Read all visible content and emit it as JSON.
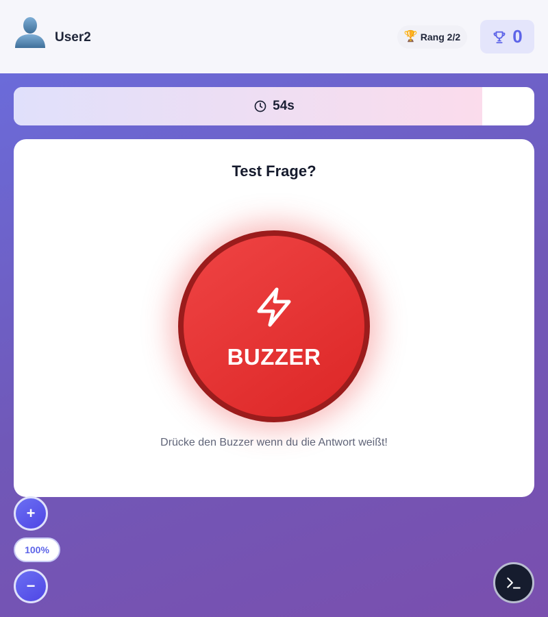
{
  "header": {
    "username": "User2",
    "rank_label": "Rang 2/2",
    "rank_icon": "trophy-emoji",
    "score": "0",
    "score_icon": "trophy-icon"
  },
  "timer": {
    "text": "54s",
    "icon": "clock-icon",
    "remaining_fraction": 0.9
  },
  "question": {
    "text": "Test Frage?",
    "buzzer_label": "BUZZER",
    "buzzer_icon": "lightning-icon",
    "hint": "Drücke den Buzzer wenn du die Antwort weißt!"
  },
  "zoom": {
    "plus_label": "+",
    "level": "100%",
    "minus_label": "−"
  },
  "terminal": {
    "icon": "terminal-icon"
  },
  "colors": {
    "accent": "#5d64e8",
    "buzzer_red": "#dc2626",
    "buzzer_border": "#9b1c1c",
    "background_start": "#6a6fe0",
    "background_end": "#7a4fae"
  }
}
